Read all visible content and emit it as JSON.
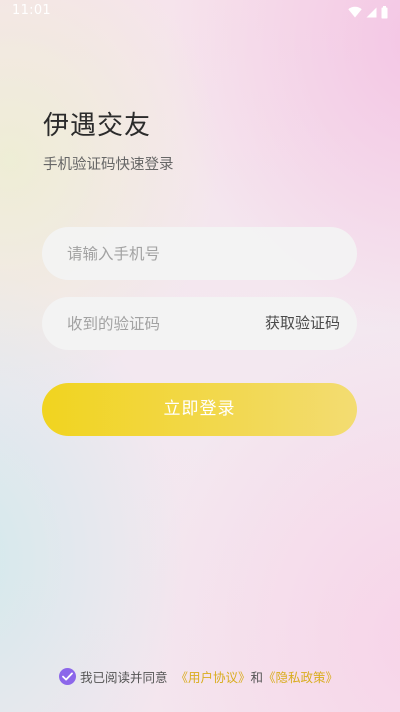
{
  "status_bar": {
    "time": "11:01",
    "icons": [
      "wifi-icon",
      "signal-icon",
      "battery-icon"
    ]
  },
  "header": {
    "title": "伊遇交友",
    "subtitle": "手机验证码快速登录"
  },
  "form": {
    "phone_placeholder": "请输入手机号",
    "phone_value": "",
    "code_placeholder": "收到的验证码",
    "code_value": "",
    "get_code_label": "获取验证码",
    "login_label": "立即登录"
  },
  "agreement": {
    "checked": true,
    "prefix": "我已阅读并同意",
    "user_agreement": "《用户协议》",
    "and": "和",
    "privacy_policy": "《隐私政策》"
  },
  "colors": {
    "button_start": "#f1d41f",
    "button_end": "#f3dc72",
    "checkbox": "#8c67ea",
    "link": "#d9ad1f"
  }
}
